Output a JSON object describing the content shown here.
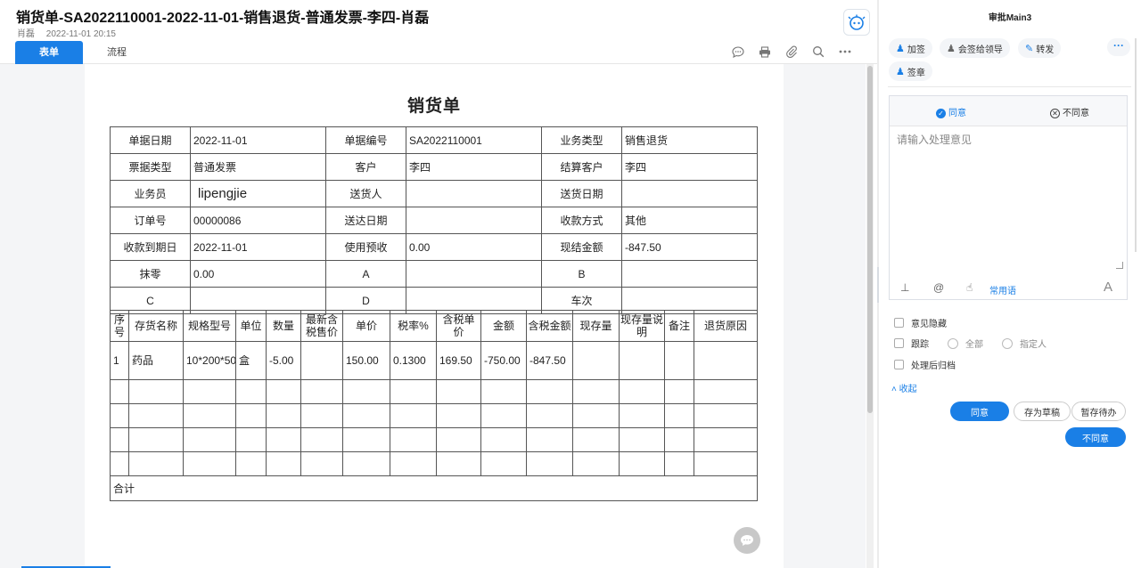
{
  "header": {
    "title": "销货单-SA2022110001-2022-11-01-销售退货-普通发票-李四-肖磊",
    "author": "肖磊",
    "datetime": "2022-11-01 20:15"
  },
  "tabs": [
    {
      "label": "表单",
      "active": true
    },
    {
      "label": "流程",
      "active": false
    }
  ],
  "toolbar_icons": [
    "comment-icon",
    "print-icon",
    "attachment-icon",
    "search-icon",
    "more-icon"
  ],
  "form": {
    "title": "销货单",
    "rows": [
      [
        {
          "label": "单据日期",
          "value": "2022-11-01"
        },
        {
          "label": "单据编号",
          "value": "SA2022110001"
        },
        {
          "label": "业务类型",
          "value": "销售退货"
        }
      ],
      [
        {
          "label": "票据类型",
          "value": "普通发票"
        },
        {
          "label": "客户",
          "value": "李四"
        },
        {
          "label": "结算客户",
          "value": "李四"
        }
      ],
      [
        {
          "label": "业务员",
          "value": "lipengjie"
        },
        {
          "label": "送货人",
          "value": ""
        },
        {
          "label": "送货日期",
          "value": ""
        }
      ],
      [
        {
          "label": "订单号",
          "value": "00000086"
        },
        {
          "label": "送达日期",
          "value": ""
        },
        {
          "label": "收款方式",
          "value": "其他"
        }
      ],
      [
        {
          "label": "收款到期日",
          "value": "2022-11-01"
        },
        {
          "label": "使用预收",
          "value": "0.00"
        },
        {
          "label": "现结金额",
          "value": "-847.50"
        }
      ],
      [
        {
          "label": "抹零",
          "value": "0.00"
        },
        {
          "label": "A",
          "value": ""
        },
        {
          "label": "B",
          "value": ""
        }
      ],
      [
        {
          "label": "C",
          "value": ""
        },
        {
          "label": "D",
          "value": ""
        },
        {
          "label": "车次",
          "value": ""
        }
      ]
    ],
    "items": {
      "columns": [
        "序号",
        "存货名称",
        "规格型号",
        "单位",
        "数量",
        "最新含税售价",
        "单价",
        "税率%",
        "含税单价",
        "金额",
        "含税金额",
        "现存量",
        "现存量说明",
        "备注",
        "退货原因"
      ],
      "rows": [
        [
          "1",
          "药品",
          "10*200*50",
          "盒",
          "-5.00",
          "",
          "150.00",
          "0.1300",
          "169.50",
          "-750.00",
          "-847.50",
          "",
          "",
          "",
          ""
        ],
        [
          "",
          "",
          "",
          "",
          "",
          "",
          "",
          "",
          "",
          "",
          "",
          "",
          "",
          "",
          ""
        ],
        [
          "",
          "",
          "",
          "",
          "",
          "",
          "",
          "",
          "",
          "",
          "",
          "",
          "",
          "",
          ""
        ],
        [
          "",
          "",
          "",
          "",
          "",
          "",
          "",
          "",
          "",
          "",
          "",
          "",
          "",
          "",
          ""
        ],
        [
          "",
          "",
          "",
          "",
          "",
          "",
          "",
          "",
          "",
          "",
          "",
          "",
          "",
          "",
          ""
        ]
      ],
      "total_label": "合计"
    }
  },
  "approval": {
    "title": "审批Main3",
    "actions": [
      {
        "label": "加签",
        "icon": "add-signer-icon"
      },
      {
        "label": "会签给领导",
        "icon": "countersign-icon"
      },
      {
        "label": "转发",
        "icon": "forward-icon"
      },
      {
        "label": "签章",
        "icon": "seal-icon"
      }
    ],
    "more": "···",
    "opinion_tabs": {
      "agree": "同意",
      "disagree": "不同意"
    },
    "opinion_placeholder": "请输入处理意见",
    "phrase_label": "常用语",
    "options": {
      "hide_opinion": "意见隐藏",
      "track": "跟踪",
      "track_all": "全部",
      "track_assigned": "指定人",
      "archive": "处理后归档"
    },
    "fold_label": "收起",
    "buttons": {
      "agree": "同意",
      "save_draft": "存为草稿",
      "hold": "暂存待办",
      "disagree": "不同意"
    }
  }
}
